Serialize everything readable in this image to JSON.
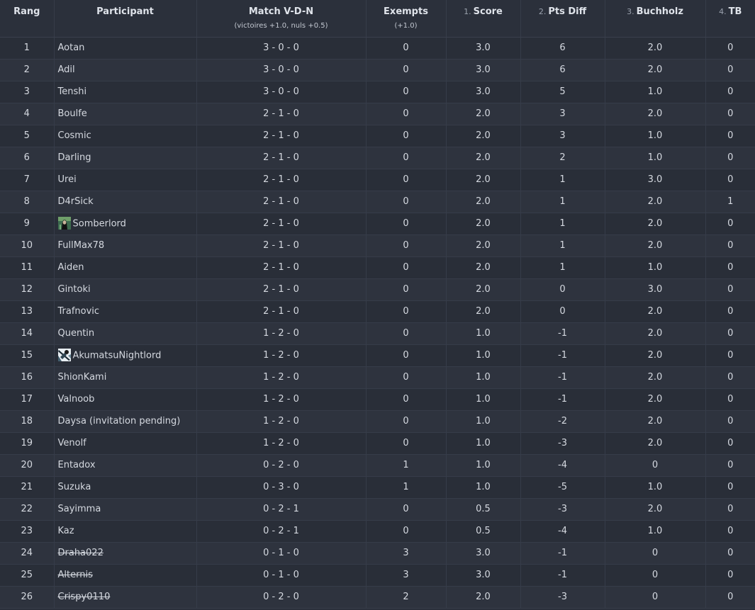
{
  "headers": {
    "rank": {
      "label": "Rang"
    },
    "participant": {
      "label": "Participant"
    },
    "match": {
      "label": "Match V-D-N",
      "sub": "(victoires +1.0, nuls +0.5)"
    },
    "exempts": {
      "label": "Exempts",
      "sub": "(+1.0)"
    },
    "score": {
      "num": "1.",
      "label": "Score"
    },
    "ptsdiff": {
      "num": "2.",
      "label": "Pts Diff"
    },
    "buchholz": {
      "num": "3.",
      "label": "Buchholz"
    },
    "tb": {
      "num": "4.",
      "label": "TB"
    }
  },
  "rows": [
    {
      "rank": "1",
      "name": "Aotan",
      "match": "3 - 0 - 0",
      "exempts": "0",
      "score": "3.0",
      "diff": "6",
      "buchholz": "2.0",
      "tb": "0"
    },
    {
      "rank": "2",
      "name": "Adil",
      "match": "3 - 0 - 0",
      "exempts": "0",
      "score": "3.0",
      "diff": "6",
      "buchholz": "2.0",
      "tb": "0"
    },
    {
      "rank": "3",
      "name": "Tenshi",
      "match": "3 - 0 - 0",
      "exempts": "0",
      "score": "3.0",
      "diff": "5",
      "buchholz": "1.0",
      "tb": "0"
    },
    {
      "rank": "4",
      "name": "Boulfe",
      "match": "2 - 1 - 0",
      "exempts": "0",
      "score": "2.0",
      "diff": "3",
      "buchholz": "2.0",
      "tb": "0"
    },
    {
      "rank": "5",
      "name": "Cosmic",
      "match": "2 - 1 - 0",
      "exempts": "0",
      "score": "2.0",
      "diff": "3",
      "buchholz": "1.0",
      "tb": "0"
    },
    {
      "rank": "6",
      "name": "Darling",
      "match": "2 - 1 - 0",
      "exempts": "0",
      "score": "2.0",
      "diff": "2",
      "buchholz": "1.0",
      "tb": "0"
    },
    {
      "rank": "7",
      "name": "Urei",
      "match": "2 - 1 - 0",
      "exempts": "0",
      "score": "2.0",
      "diff": "1",
      "buchholz": "3.0",
      "tb": "0"
    },
    {
      "rank": "8",
      "name": "D4rSick",
      "match": "2 - 1 - 0",
      "exempts": "0",
      "score": "2.0",
      "diff": "1",
      "buchholz": "2.0",
      "tb": "1"
    },
    {
      "rank": "9",
      "name": "Somberlord",
      "avatar": "somberlord-avatar",
      "match": "2 - 1 - 0",
      "exempts": "0",
      "score": "2.0",
      "diff": "1",
      "buchholz": "2.0",
      "tb": "0"
    },
    {
      "rank": "10",
      "name": "FullMax78",
      "match": "2 - 1 - 0",
      "exempts": "0",
      "score": "2.0",
      "diff": "1",
      "buchholz": "2.0",
      "tb": "0"
    },
    {
      "rank": "11",
      "name": "Aiden",
      "match": "2 - 1 - 0",
      "exempts": "0",
      "score": "2.0",
      "diff": "1",
      "buchholz": "1.0",
      "tb": "0"
    },
    {
      "rank": "12",
      "name": "Gintoki",
      "match": "2 - 1 - 0",
      "exempts": "0",
      "score": "2.0",
      "diff": "0",
      "buchholz": "3.0",
      "tb": "0"
    },
    {
      "rank": "13",
      "name": "Trafnovic",
      "match": "2 - 1 - 0",
      "exempts": "0",
      "score": "2.0",
      "diff": "0",
      "buchholz": "2.0",
      "tb": "0"
    },
    {
      "rank": "14",
      "name": "Quentin",
      "match": "1 - 2 - 0",
      "exempts": "0",
      "score": "1.0",
      "diff": "-1",
      "buchholz": "2.0",
      "tb": "0"
    },
    {
      "rank": "15",
      "name": "AkumatsuNightlord",
      "avatar": "akumatsu-avatar",
      "match": "1 - 2 - 0",
      "exempts": "0",
      "score": "1.0",
      "diff": "-1",
      "buchholz": "2.0",
      "tb": "0"
    },
    {
      "rank": "16",
      "name": "ShionKami",
      "match": "1 - 2 - 0",
      "exempts": "0",
      "score": "1.0",
      "diff": "-1",
      "buchholz": "2.0",
      "tb": "0"
    },
    {
      "rank": "17",
      "name": "Valnoob",
      "match": "1 - 2 - 0",
      "exempts": "0",
      "score": "1.0",
      "diff": "-1",
      "buchholz": "2.0",
      "tb": "0"
    },
    {
      "rank": "18",
      "name": "Daysa (invitation pending)",
      "match": "1 - 2 - 0",
      "exempts": "0",
      "score": "1.0",
      "diff": "-2",
      "buchholz": "2.0",
      "tb": "0"
    },
    {
      "rank": "19",
      "name": "Venolf",
      "match": "1 - 2 - 0",
      "exempts": "0",
      "score": "1.0",
      "diff": "-3",
      "buchholz": "2.0",
      "tb": "0"
    },
    {
      "rank": "20",
      "name": "Entadox",
      "match": "0 - 2 - 0",
      "exempts": "1",
      "score": "1.0",
      "diff": "-4",
      "buchholz": "0",
      "tb": "0"
    },
    {
      "rank": "21",
      "name": "Suzuka",
      "match": "0 - 3 - 0",
      "exempts": "1",
      "score": "1.0",
      "diff": "-5",
      "buchholz": "1.0",
      "tb": "0"
    },
    {
      "rank": "22",
      "name": "Sayimma",
      "match": "0 - 2 - 1",
      "exempts": "0",
      "score": "0.5",
      "diff": "-3",
      "buchholz": "2.0",
      "tb": "0"
    },
    {
      "rank": "23",
      "name": "Kaz",
      "match": "0 - 2 - 1",
      "exempts": "0",
      "score": "0.5",
      "diff": "-4",
      "buchholz": "1.0",
      "tb": "0"
    },
    {
      "rank": "24",
      "name": "Draha022",
      "struck": true,
      "match": "0 - 1 - 0",
      "exempts": "3",
      "score": "3.0",
      "diff": "-1",
      "buchholz": "0",
      "tb": "0"
    },
    {
      "rank": "25",
      "name": "Alternis",
      "struck": true,
      "match": "0 - 1 - 0",
      "exempts": "3",
      "score": "3.0",
      "diff": "-1",
      "buchholz": "0",
      "tb": "0"
    },
    {
      "rank": "26",
      "name": "Crispy0110",
      "struck": true,
      "match": "0 - 2 - 0",
      "exempts": "2",
      "score": "2.0",
      "diff": "-3",
      "buchholz": "0",
      "tb": "0"
    }
  ]
}
